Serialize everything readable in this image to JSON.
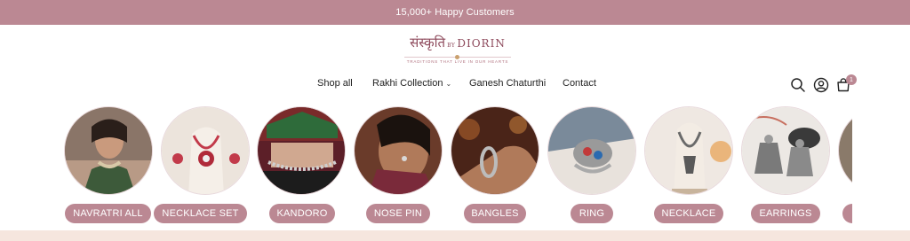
{
  "announcement": {
    "text": "15,000+ Happy Customers"
  },
  "logo": {
    "hindi": "संस्कृति",
    "by": "BY",
    "brand": "DIORIN",
    "tagline": "TRADITIONS THAT LIVE IN OUR HEARTS"
  },
  "nav": {
    "items": [
      {
        "label": "Shop all"
      },
      {
        "label": "Rakhi Collection",
        "dropdown": true
      },
      {
        "label": "Ganesh Chaturthi"
      },
      {
        "label": "Contact"
      }
    ]
  },
  "header_icons": {
    "search": "search-icon",
    "account": "account-icon",
    "cart": "cart-icon",
    "cart_count": "1"
  },
  "categories": [
    {
      "label": "NAVRATRI ALL"
    },
    {
      "label": "NECKLACE SET"
    },
    {
      "label": "KANDORO"
    },
    {
      "label": "NOSE PIN"
    },
    {
      "label": "BANGLES"
    },
    {
      "label": "RING"
    },
    {
      "label": "NECKLACE"
    },
    {
      "label": "EARRINGS"
    }
  ],
  "colors": {
    "accent": "#bb8893",
    "brand": "#8e4a5c",
    "band": "#f6e6de"
  }
}
